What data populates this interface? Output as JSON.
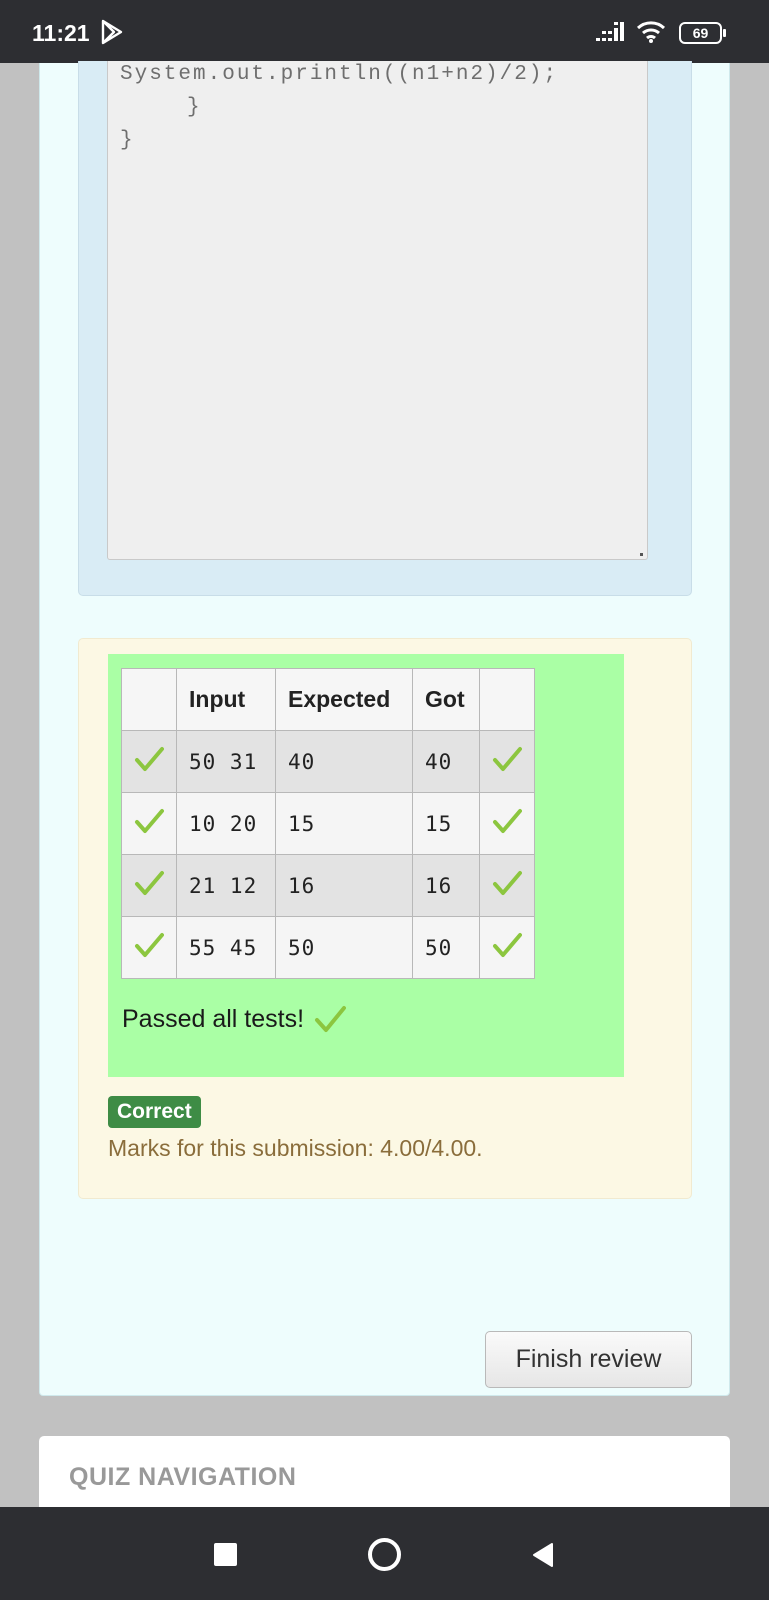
{
  "status_bar": {
    "time": "11:21",
    "battery": "69",
    "icons": [
      "play-store-icon",
      "signal-icon",
      "wifi-icon",
      "battery-icon"
    ]
  },
  "code": {
    "lines": [
      "System.out.println((n1+n2)/2);",
      "}",
      "}"
    ]
  },
  "results": {
    "headers": [
      "",
      "Input",
      "Expected",
      "Got",
      ""
    ],
    "rows": [
      {
        "input": "50 31",
        "expected": "40",
        "got": "40",
        "passed": true
      },
      {
        "input": "10 20",
        "expected": "15",
        "got": "15",
        "passed": true
      },
      {
        "input": "21 12",
        "expected": "16",
        "got": "16",
        "passed": true
      },
      {
        "input": "55 45",
        "expected": "50",
        "got": "50",
        "passed": true
      }
    ],
    "summary": "Passed all tests!"
  },
  "grading": {
    "badge": "Correct",
    "marks_text": "Marks for this submission: 4.00/4.00."
  },
  "finish_button": "Finish review",
  "quiz_navigation": {
    "title": "QUIZ NAVIGATION"
  },
  "colors": {
    "check": "#8cc63f",
    "badge": "#3e8c45",
    "pass_bg": "#aaffa5",
    "marks_text": "#8a6d3b"
  }
}
